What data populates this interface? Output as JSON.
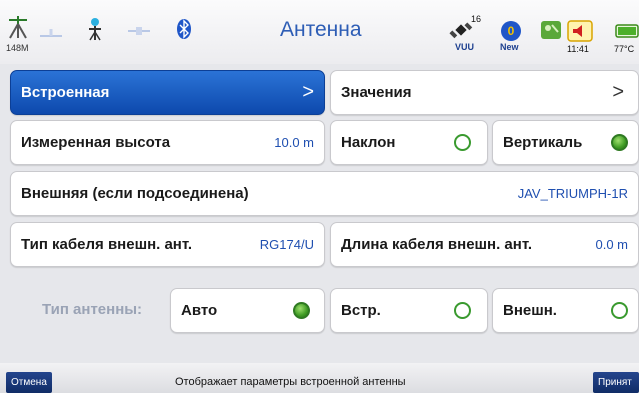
{
  "header": {
    "title": "Антенна",
    "memory_label": "148M",
    "sat_count": "16",
    "sat_label": "VUU",
    "new_label": "New",
    "time": "11:41",
    "temperature": "77°C"
  },
  "main": {
    "builtin_label": "Встроенная",
    "values_label": "Значения",
    "chevron": ">",
    "measured_height_label": "Измеренная высота",
    "measured_height_value": "10.0 m",
    "tilt_label": "Наклон",
    "vertical_label": "Вертикаль",
    "external_label": "Внешняя (если подсоединена)",
    "external_value": "JAV_TRIUMPH-1R",
    "cable_type_label": "Тип кабеля внешн. ант.",
    "cable_type_value": "RG174/U",
    "cable_length_label": "Длина кабеля внешн. ант.",
    "cable_length_value": "0.0 m",
    "antenna_type_label": "Тип антенны:",
    "auto_label": "Авто",
    "builtin_short_label": "Встр.",
    "external_short_label": "Внешн."
  },
  "footer": {
    "cancel_label": "Отмена",
    "hint": "Отображает параметры встроенной антенны",
    "accept_label": "Принят"
  },
  "colors": {
    "accent": "#0d49ad",
    "title": "#2d5db5",
    "value": "#1f4fb0",
    "radio_on": "#3f9c24"
  },
  "states": {
    "tilt": false,
    "vertical": true,
    "auto": true,
    "builtin_short": false,
    "external_short": false
  }
}
